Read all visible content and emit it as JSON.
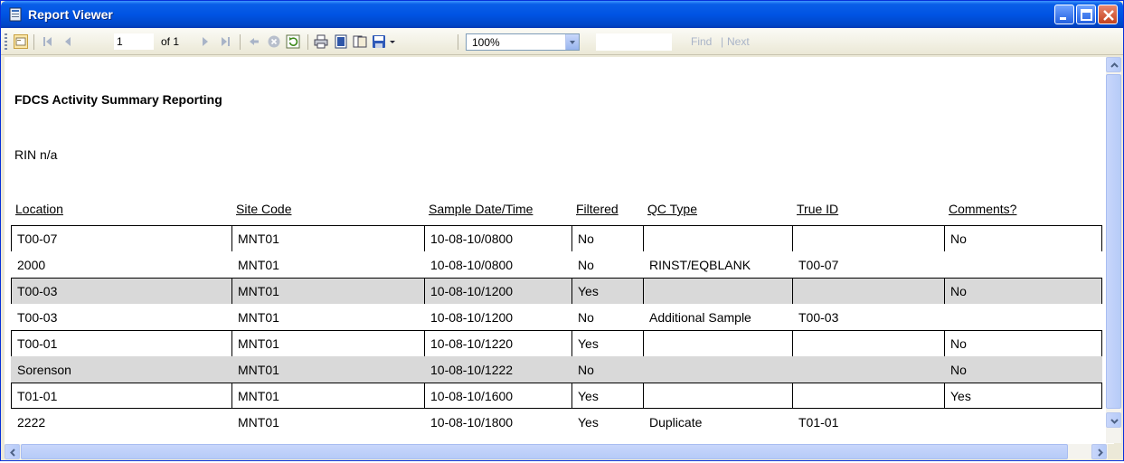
{
  "window": {
    "title": "Report Viewer"
  },
  "toolbar": {
    "page_value": "1",
    "page_of": "of 1",
    "zoom": "100%",
    "find_value": "",
    "find_label": "Find",
    "find_separator": "|",
    "next_label": "Next"
  },
  "report": {
    "title": "FDCS Activity Summary Reporting",
    "rin": "RIN n/a",
    "columns": [
      "Location",
      "Site Code",
      "Sample Date/Time",
      "Filtered",
      "QC Type",
      "True ID",
      "Comments?"
    ],
    "rows": [
      [
        "T00-07",
        "MNT01",
        "10-08-10/0800",
        "No",
        "",
        "",
        "No"
      ],
      [
        "2000",
        "MNT01",
        "10-08-10/0800",
        "No",
        "RINST/EQBLANK",
        "T00-07",
        ""
      ],
      [
        "T00-03",
        "MNT01",
        "10-08-10/1200",
        "Yes",
        "",
        "",
        "No"
      ],
      [
        "T00-03",
        "MNT01",
        "10-08-10/1200",
        "No",
        "Additional Sample",
        "T00-03",
        ""
      ],
      [
        "T00-01",
        "MNT01",
        "10-08-10/1220",
        "Yes",
        "",
        "",
        "No"
      ],
      [
        "Sorenson",
        "MNT01",
        "10-08-10/1222",
        "No",
        "",
        "",
        "No"
      ],
      [
        "T01-01",
        "MNT01",
        "10-08-10/1600",
        "Yes",
        "",
        "",
        "Yes"
      ],
      [
        "2222",
        "MNT01",
        "10-08-10/1800",
        "Yes",
        "Duplicate",
        "T01-01",
        ""
      ]
    ]
  },
  "colors": {
    "titlebar": "#0054e3",
    "row_highlight": "#d9d9d9",
    "chrome": "#ece9d8"
  },
  "icons": {
    "title": "report-viewer-icon",
    "toolbar": [
      "toggle-parameters-icon",
      "first-page-icon",
      "previous-page-icon",
      "next-page-icon",
      "last-page-icon",
      "back-icon",
      "stop-icon",
      "refresh-icon",
      "print-icon",
      "print-layout-icon",
      "page-setup-icon",
      "export-icon"
    ]
  }
}
